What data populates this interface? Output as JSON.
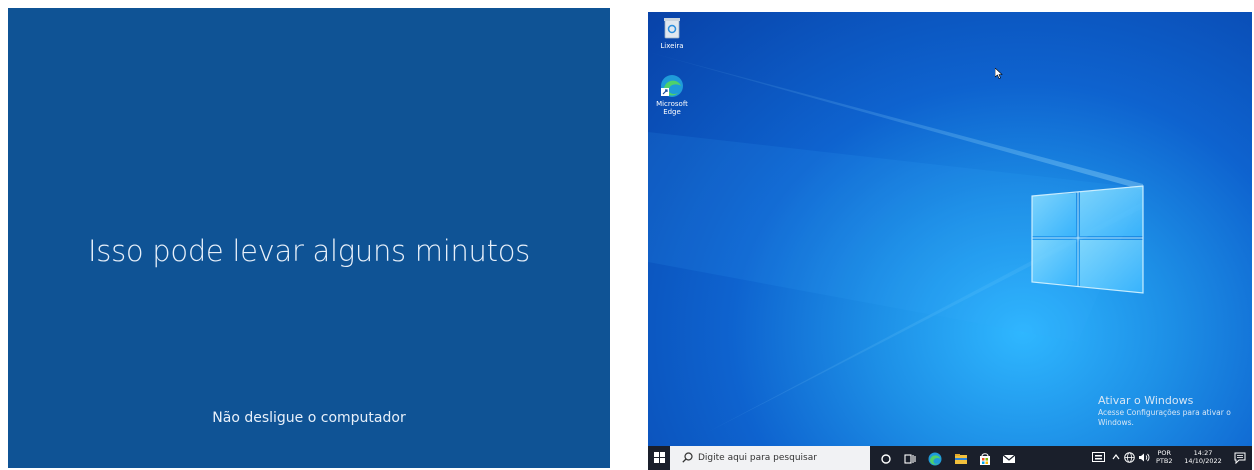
{
  "setup_screen": {
    "main_message": "Isso pode levar alguns minutos",
    "sub_message": "Não desligue o computador"
  },
  "desktop": {
    "icons": [
      {
        "label": "Lixeira",
        "icon": "recycle-bin-icon"
      },
      {
        "label": "Microsoft Edge",
        "icon": "edge-icon"
      }
    ],
    "watermark": {
      "title": "Ativar o Windows",
      "subtitle": "Acesse Configurações para ativar o Windows."
    },
    "taskbar": {
      "search_placeholder": "Digite aqui para pesquisar",
      "tray": {
        "language": "POR",
        "layout": "PTB2",
        "time": "14:27",
        "date": "14/10/2022"
      }
    }
  },
  "colors": {
    "setup_background": "#0f5395",
    "taskbar": "#1a1f2b",
    "desktop_accent": "#2fb7ff"
  }
}
